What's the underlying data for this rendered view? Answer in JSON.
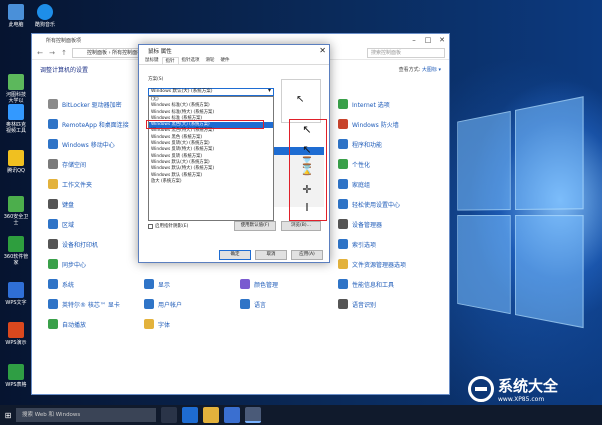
{
  "desktop": {
    "icons": [
      {
        "label": "此电脑",
        "color": "#4a90d9"
      },
      {
        "label": "河图科技 大学以",
        "color": "#5cb85c"
      },
      {
        "label": "奥林匹克 视频工具",
        "color": "#3399ff"
      },
      {
        "label": "腾讯QQ",
        "color": "#f0c020"
      },
      {
        "label": "360安全卫士",
        "color": "#4cae4c"
      },
      {
        "label": "360软件管家",
        "color": "#2e9e3e"
      },
      {
        "label": "WPS文字",
        "color": "#2f6fd6"
      },
      {
        "label": "WPS演示",
        "color": "#d9481e"
      },
      {
        "label": "WPS表格",
        "color": "#2f9e44"
      }
    ],
    "top_icon": {
      "label": "酷狗音乐",
      "color": "#1e8ee8"
    }
  },
  "control_panel": {
    "title": "所有控制面板项",
    "address": "控制面板 › 所有控制面板项",
    "search_placeholder": "搜索控制面板",
    "heading": "调整计算机的设置",
    "view_by_label": "查看方式:",
    "view_by_value": "大图标 ▾",
    "left_items": [
      {
        "label": "BitLocker 驱动器加密",
        "color": "#8a8a8a"
      },
      {
        "label": "RemoteApp 和桌面连接",
        "color": "#2f74c7"
      },
      {
        "label": "Windows 移动中心",
        "color": "#2f74c7"
      },
      {
        "label": "存储空间",
        "color": "#7a7a7a"
      },
      {
        "label": "工作文件夹",
        "color": "#e3b23c"
      },
      {
        "label": "键盘",
        "color": "#555"
      },
      {
        "label": "区域",
        "color": "#2f74c7"
      },
      {
        "label": "设备和打印机",
        "color": "#555"
      },
      {
        "label": "同步中心",
        "color": "#3aa04a"
      },
      {
        "label": "系统",
        "color": "#2f74c7"
      },
      {
        "label": "英特尔® 核芯™ 显卡",
        "color": "#2f74c7"
      },
      {
        "label": "自动播放",
        "color": "#3aa04a"
      }
    ],
    "mid_items": [
      {
        "label": "显示",
        "color": "#2f74c7"
      },
      {
        "label": "用户帐户",
        "color": "#2f74c7"
      },
      {
        "label": "字体",
        "color": "#e3b23c"
      }
    ],
    "mid2_items": [
      {
        "label": "颜色管理",
        "color": "#7a5bd0"
      },
      {
        "label": "语言",
        "color": "#2f74c7"
      }
    ],
    "right_items": [
      {
        "label": "Internet 选项",
        "color": "#3aa04a"
      },
      {
        "label": "Windows 防火墙",
        "color": "#c8442c"
      },
      {
        "label": "程序和功能",
        "color": "#2f74c7"
      },
      {
        "label": "个性化",
        "color": "#3aa04a"
      },
      {
        "label": "家庭组",
        "color": "#2f74c7"
      },
      {
        "label": "轻松使用设置中心",
        "color": "#2f74c7"
      },
      {
        "label": "设备管理器",
        "color": "#555"
      },
      {
        "label": "索引选项",
        "color": "#2f74c7"
      },
      {
        "label": "文件资源管理器选项",
        "color": "#e3b23c"
      },
      {
        "label": "性能信息和工具",
        "color": "#2f74c7"
      },
      {
        "label": "语音识别",
        "color": "#555"
      }
    ]
  },
  "mouse_dialog": {
    "title": "鼠标 属性",
    "tabs": [
      "鼠标键",
      "指针",
      "指针选项",
      "滑轮",
      "硬件"
    ],
    "active_tab": "指针",
    "scheme_label": "方案(S)",
    "scheme_value": "Windows 默认(大) (系统方案)",
    "options": [
      "(无)",
      "Windows 标准(大) (系统方案)",
      "Windows 标准(特大) (系统方案)",
      "Windows 标准 (系统方案)",
      "Windows 黑色(大) (系统方案)",
      "Windows 黑色(特大) (系统方案)",
      "Windows 黑色 (系统方案)",
      "Windows 反转(大) (系统方案)",
      "Windows 反转(特大) (系统方案)",
      "Windows 反转 (系统方案)",
      "Windows 默认(大) (系统方案)",
      "Windows 默认(特大) (系统方案)",
      "Windows 默认 (系统方案)",
      "放大 (系统方案)"
    ],
    "selected_option_index": 4,
    "normal_select_label": "精确选择",
    "text_select_label": "文本选择",
    "shadow_checkbox": "启用指针阴影(E)",
    "use_default_button": "使用默认值(F)",
    "browse_button": "浏览(B)...",
    "ok_button": "确定",
    "cancel_button": "取消",
    "apply_button": "应用(A)"
  },
  "cursor_preview": [
    "↖",
    "↖⌛",
    "⌛",
    "✛",
    "I"
  ],
  "taskbar": {
    "search_text": "搜索 Web 和 Windows"
  },
  "watermark": {
    "name": "系统大全",
    "url": "www.XP85.com"
  }
}
